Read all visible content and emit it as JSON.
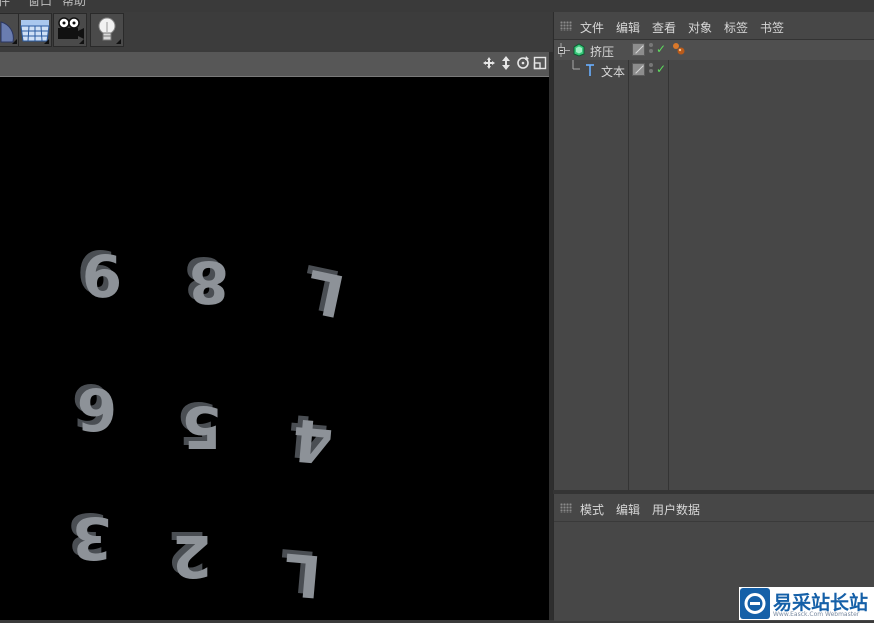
{
  "menubar": {
    "items": [
      "件",
      "窗口",
      "帮助"
    ]
  },
  "toolbar": {
    "buttons": [
      {
        "name": "deformer-tool",
        "icon": "deformer-icon"
      },
      {
        "name": "floor-scene",
        "icon": "floor-icon"
      },
      {
        "name": "camera",
        "icon": "camera-icon"
      },
      {
        "name": "light",
        "icon": "light-bulb-icon"
      }
    ]
  },
  "viewport": {
    "header_icons": [
      "move-view-icon",
      "pan-view-icon",
      "rotate-view-icon",
      "maximize-view-icon"
    ],
    "background": "#000000",
    "digit_color": "#9aa0a6"
  },
  "object_manager": {
    "menu": [
      "文件",
      "编辑",
      "查看",
      "对象",
      "标签",
      "书签"
    ],
    "objects": [
      {
        "label": "挤压",
        "type": "extrude",
        "icon": "extrude-object-icon",
        "visible_check": "✓"
      },
      {
        "label": "文本",
        "type": "text",
        "icon": "text-spline-icon",
        "visible_check": "✓"
      }
    ],
    "check_color": "#5ddc5d"
  },
  "attribute_manager": {
    "menu": [
      "模式",
      "编辑",
      "用户数据"
    ]
  },
  "watermark": {
    "title": "易采站长站",
    "subtitle": "Www.Easck.Com  Webmaster"
  }
}
